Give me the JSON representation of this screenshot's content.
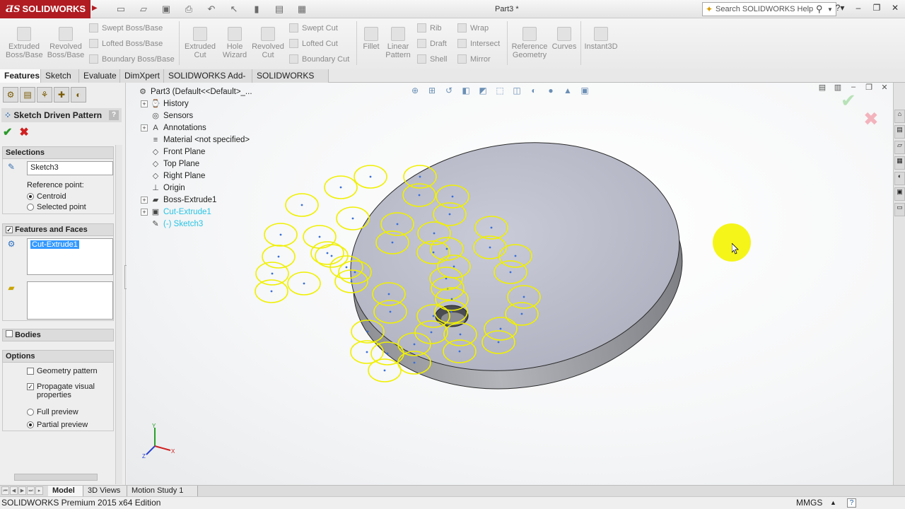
{
  "app": {
    "logo": "SOLIDWORKS",
    "document_title": "Part3 *",
    "search_placeholder": "Search SOLIDWORKS Help",
    "accent": "#b01c22"
  },
  "ribbon": {
    "large_buttons": [
      {
        "label": "Extruded\nBoss/Base"
      },
      {
        "label": "Revolved\nBoss/Base"
      },
      {
        "label": "Extruded\nCut"
      },
      {
        "label": "Hole\nWizard"
      },
      {
        "label": "Revolved\nCut"
      },
      {
        "label": "Fillet"
      },
      {
        "label": "Linear\nPattern"
      },
      {
        "label": "Reference\nGeometry"
      },
      {
        "label": "Curves"
      },
      {
        "label": "Instant3D"
      }
    ],
    "small_buttons": {
      "swept_boss": "Swept Boss/Base",
      "lofted_boss": "Lofted Boss/Base",
      "boundary_boss": "Boundary Boss/Base",
      "swept_cut": "Swept Cut",
      "lofted_cut": "Lofted Cut",
      "boundary_cut": "Boundary Cut",
      "rib": "Rib",
      "draft": "Draft",
      "shell": "Shell",
      "wrap": "Wrap",
      "intersect": "Intersect",
      "mirror": "Mirror"
    }
  },
  "tabs": [
    "Features",
    "Sketch",
    "Evaluate",
    "DimXpert",
    "SOLIDWORKS Add-Ins",
    "SOLIDWORKS MBD"
  ],
  "property_manager": {
    "title": "Sketch Driven Pattern",
    "help": "?",
    "selections": {
      "header": "Selections",
      "sketch_value": "Sketch3",
      "reference_point_label": "Reference point:",
      "centroid": "Centroid",
      "selected_point": "Selected point"
    },
    "features_and_faces": {
      "header": "Features and Faces",
      "feature_value": "Cut-Extrude1"
    },
    "bodies": {
      "header": "Bodies"
    },
    "options": {
      "header": "Options",
      "geometry_pattern": "Geometry pattern",
      "propagate_visual": "Propagate visual\nproperties",
      "full_preview": "Full preview",
      "partial_preview": "Partial preview"
    }
  },
  "feature_tree": [
    {
      "label": "Part3  (Default<<Default>_...",
      "icon": "part-icon",
      "expander": "",
      "style": "normal"
    },
    {
      "label": "History",
      "icon": "history-icon",
      "expander": "+",
      "style": "normal"
    },
    {
      "label": "Sensors",
      "icon": "sensors-icon",
      "expander": "",
      "style": "normal"
    },
    {
      "label": "Annotations",
      "icon": "annotations-icon",
      "expander": "+",
      "style": "normal"
    },
    {
      "label": "Material <not specified>",
      "icon": "material-icon",
      "expander": "",
      "style": "normal"
    },
    {
      "label": "Front Plane",
      "icon": "plane-icon",
      "expander": "",
      "style": "normal"
    },
    {
      "label": "Top Plane",
      "icon": "plane-icon",
      "expander": "",
      "style": "normal"
    },
    {
      "label": "Right Plane",
      "icon": "plane-icon",
      "expander": "",
      "style": "normal"
    },
    {
      "label": "Origin",
      "icon": "origin-icon",
      "expander": "",
      "style": "normal"
    },
    {
      "label": "Boss-Extrude1",
      "icon": "extrude-icon",
      "expander": "+",
      "style": "normal"
    },
    {
      "label": "Cut-Extrude1",
      "icon": "cut-extrude-icon",
      "expander": "+",
      "style": "cyan"
    },
    {
      "label": "(-) Sketch3",
      "icon": "sketch-icon",
      "expander": "",
      "style": "cyan"
    }
  ],
  "bottom_tabs": [
    "Model",
    "3D Views",
    "Motion Study 1"
  ],
  "status": {
    "edition": "SOLIDWORKS Premium 2015 x64 Edition",
    "units": "MMGS",
    "units_dropdown": "▲",
    "help": "?"
  },
  "triad_labels": {
    "x": "X",
    "y": "Y",
    "z": "Z"
  }
}
